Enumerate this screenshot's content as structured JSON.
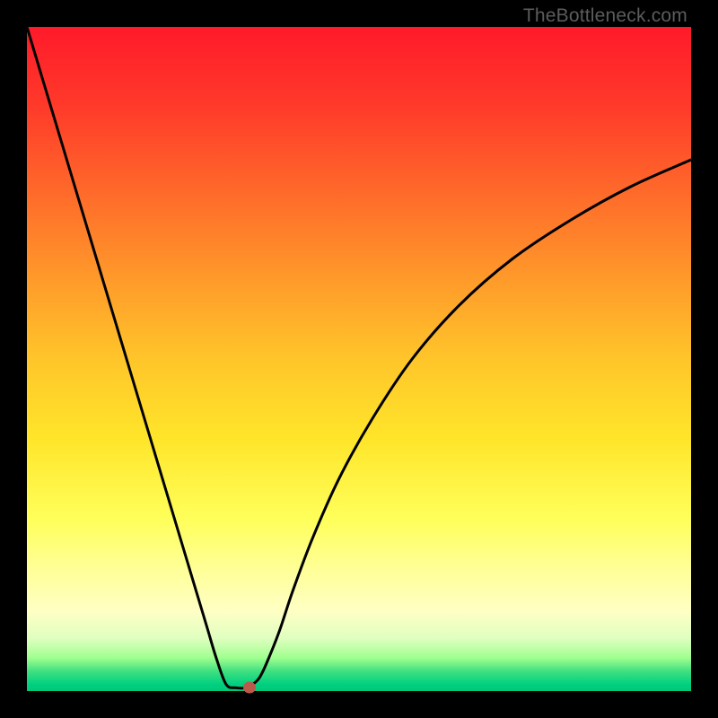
{
  "watermark": "TheBottleneck.com",
  "chart_data": {
    "type": "line",
    "title": "",
    "xlabel": "",
    "ylabel": "",
    "xlim": [
      0,
      100
    ],
    "ylim": [
      0,
      100
    ],
    "gradient_stops": [
      {
        "pos": 0,
        "color": "#ff1a2a"
      },
      {
        "pos": 25,
        "color": "#ff6a2a"
      },
      {
        "pos": 50,
        "color": "#ffc52a"
      },
      {
        "pos": 75,
        "color": "#ffff5a"
      },
      {
        "pos": 92,
        "color": "#e0ffc0"
      },
      {
        "pos": 100,
        "color": "#00c878"
      }
    ],
    "series": [
      {
        "name": "curve",
        "x": [
          0.0,
          3.0,
          6.0,
          9.0,
          12.0,
          15.0,
          18.0,
          21.0,
          24.0,
          27.0,
          28.5,
          30.0,
          31.5,
          33.0,
          34.0,
          35.0,
          36.0,
          38.0,
          40.0,
          43.0,
          47.0,
          52.0,
          58.0,
          65.0,
          73.0,
          82.0,
          91.0,
          100.0
        ],
        "y": [
          100.0,
          90.0,
          80.0,
          70.0,
          60.0,
          50.0,
          40.0,
          30.0,
          20.0,
          10.0,
          5.0,
          1.0,
          0.5,
          0.5,
          1.0,
          2.0,
          4.0,
          9.0,
          15.0,
          23.0,
          32.0,
          41.0,
          50.0,
          58.0,
          65.0,
          71.0,
          76.0,
          80.0
        ],
        "stroke": "#000000",
        "stroke_width": 3
      }
    ],
    "marker": {
      "x": 33.5,
      "y": 0.5,
      "color": "#bb5a4a"
    }
  }
}
